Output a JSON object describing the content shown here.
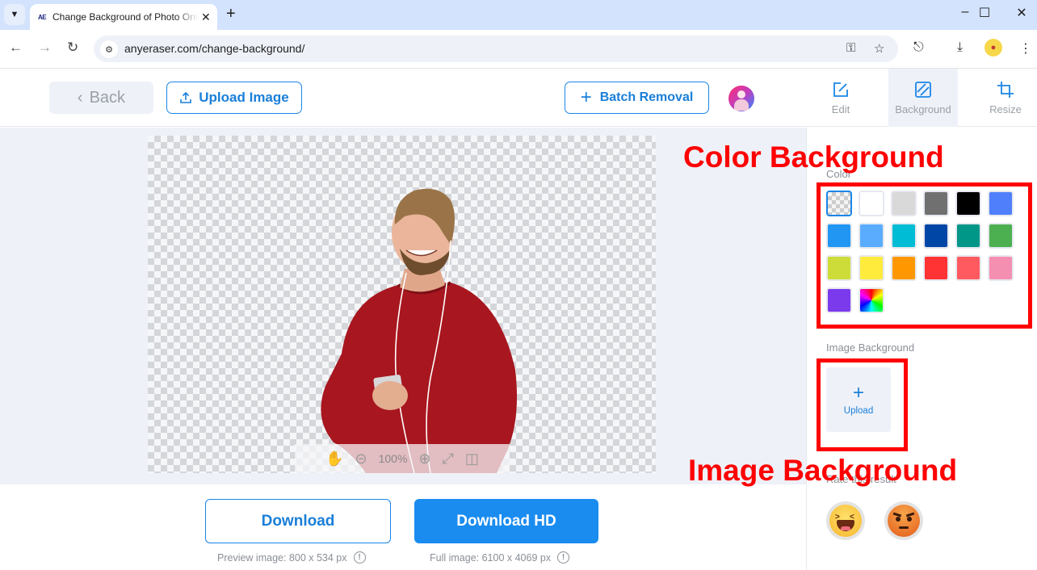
{
  "browser": {
    "tab_title": "Change Background of Photo Online",
    "tab_favicon": "AE",
    "url": "anyeraser.com/change-background/",
    "window_controls": [
      "minimize",
      "maximize",
      "close"
    ]
  },
  "header": {
    "back_label": "Back",
    "upload_label": "Upload Image",
    "batch_label": "Batch Removal",
    "tools": [
      {
        "label": "Edit",
        "icon": "edit-icon",
        "active": false
      },
      {
        "label": "Background",
        "icon": "background-icon",
        "active": true
      },
      {
        "label": "Resize",
        "icon": "crop-icon",
        "active": false
      }
    ]
  },
  "canvas": {
    "zoom_level": "100%"
  },
  "download": {
    "download_label": "Download",
    "download_hd_label": "Download HD",
    "preview_note": "Preview image: 800 x 534 px",
    "full_note": "Full image: 6100 x 4069 px"
  },
  "panel": {
    "color_label": "Color",
    "colors": [
      {
        "name": "transparent",
        "hex": "transparent",
        "selected": true
      },
      {
        "name": "white",
        "hex": "#ffffff"
      },
      {
        "name": "light-gray",
        "hex": "#d9d9d9"
      },
      {
        "name": "gray",
        "hex": "#707070"
      },
      {
        "name": "black",
        "hex": "#000000"
      },
      {
        "name": "blue",
        "hex": "#4f7ffa"
      },
      {
        "name": "sky-blue",
        "hex": "#2196f3"
      },
      {
        "name": "light-blue",
        "hex": "#5aacff"
      },
      {
        "name": "cyan",
        "hex": "#00bcd4"
      },
      {
        "name": "navy",
        "hex": "#0046a6"
      },
      {
        "name": "teal",
        "hex": "#009688"
      },
      {
        "name": "green",
        "hex": "#4caf50"
      },
      {
        "name": "lime",
        "hex": "#cddc39"
      },
      {
        "name": "yellow",
        "hex": "#ffeb3b"
      },
      {
        "name": "orange",
        "hex": "#ff9800"
      },
      {
        "name": "red",
        "hex": "#ff3333"
      },
      {
        "name": "coral",
        "hex": "#ff5a5f"
      },
      {
        "name": "pink",
        "hex": "#f48fb1"
      },
      {
        "name": "purple",
        "hex": "#7c3aed"
      },
      {
        "name": "custom",
        "hex": "rainbow"
      }
    ],
    "image_bg_label": "Image Background",
    "upload_tile_label": "Upload",
    "rate_label": "Rate this result",
    "rate_options": [
      "laugh",
      "angry"
    ]
  },
  "annotations": {
    "color_bg": "Color Background",
    "image_bg": "Image Background",
    "color": "#ff0000"
  }
}
